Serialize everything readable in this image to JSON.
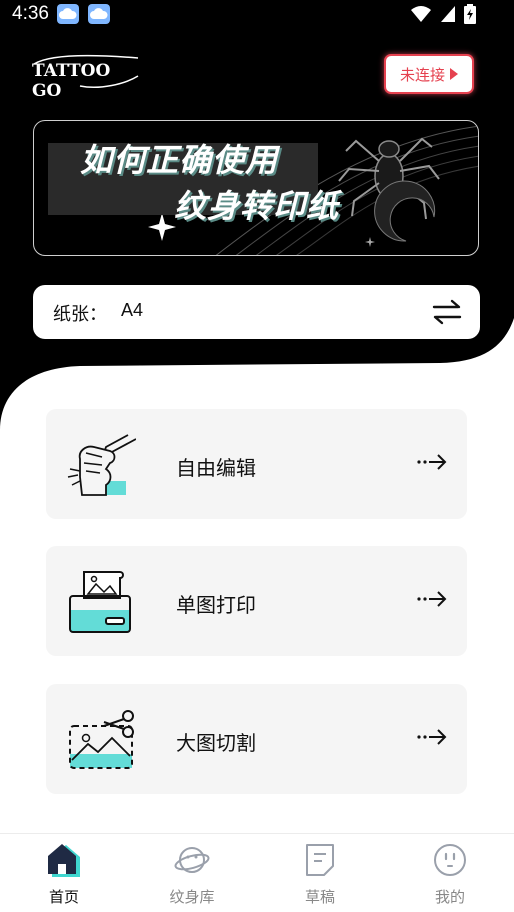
{
  "status_bar": {
    "time": "4:36"
  },
  "header": {
    "logo_text": "TATTOO GO",
    "connect_label": "未连接"
  },
  "banner": {
    "line1": "如何正确使用",
    "line2": "纹身转印纸"
  },
  "paper": {
    "label": "纸张：",
    "value": "A4"
  },
  "features": [
    {
      "label": "自由编辑",
      "icon": "hand-drawing-icon"
    },
    {
      "label": "单图打印",
      "icon": "printer-icon"
    },
    {
      "label": "大图切割",
      "icon": "scissors-cut-icon"
    }
  ],
  "nav": [
    {
      "label": "首页",
      "icon": "home-icon",
      "active": true
    },
    {
      "label": "纹身库",
      "icon": "planet-icon",
      "active": false
    },
    {
      "label": "草稿",
      "icon": "draft-icon",
      "active": false
    },
    {
      "label": "我的",
      "icon": "face-icon",
      "active": false
    }
  ],
  "colors": {
    "accent_red": "#e5414f",
    "teal": "#3fd6cf",
    "background_dark": "#000000"
  }
}
